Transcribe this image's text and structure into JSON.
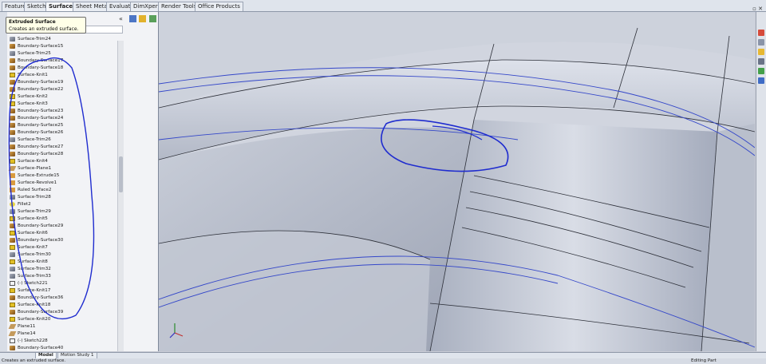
{
  "toolbar_tabs": [
    "Features",
    "Sketch",
    "Surfaces",
    "Sheet Metal",
    "Evaluate",
    "DimXpert",
    "Render Tools",
    "Office Products"
  ],
  "active_tab": "Surfaces",
  "tooltip": {
    "title": "Extruded Surface",
    "description": "Creates an extruded surface."
  },
  "tree_items": [
    {
      "label": "Surface-Trim24",
      "icon": "st"
    },
    {
      "label": "Boundary-Surface15",
      "icon": "bs"
    },
    {
      "label": "Surface-Trim25",
      "icon": "st"
    },
    {
      "label": "Boundary-Surface17",
      "icon": "bs"
    },
    {
      "label": "Boundary-Surface18",
      "icon": "bs"
    },
    {
      "label": "Surface-Knit1",
      "icon": "kn"
    },
    {
      "label": "Boundary-Surface19",
      "icon": "bs"
    },
    {
      "label": "Boundary-Surface22",
      "icon": "bs"
    },
    {
      "label": "Surface-Knit2",
      "icon": "kn"
    },
    {
      "label": "Surface-Knit3",
      "icon": "kn"
    },
    {
      "label": "Boundary-Surface23",
      "icon": "bs"
    },
    {
      "label": "Boundary-Surface24",
      "icon": "bs"
    },
    {
      "label": "Boundary-Surface25",
      "icon": "bs"
    },
    {
      "label": "Boundary-Surface26",
      "icon": "bs"
    },
    {
      "label": "Surface-Trim26",
      "icon": "st"
    },
    {
      "label": "Boundary-Surface27",
      "icon": "bs"
    },
    {
      "label": "Boundary-Surface28",
      "icon": "bs"
    },
    {
      "label": "Surface-Knit4",
      "icon": "kn"
    },
    {
      "label": "Surface-Plane1",
      "icon": "pl"
    },
    {
      "label": "Surface-Extrude15",
      "icon": "ex"
    },
    {
      "label": "Surface-Revolve1",
      "icon": "ex"
    },
    {
      "label": "Ruled Surface2",
      "icon": "ex"
    },
    {
      "label": "Surface-Trim28",
      "icon": "st"
    },
    {
      "label": "Fillet2",
      "icon": "fi"
    },
    {
      "label": "Surface-Trim29",
      "icon": "st"
    },
    {
      "label": "Surface-Knit5",
      "icon": "kn"
    },
    {
      "label": "Boundary-Surface29",
      "icon": "bs"
    },
    {
      "label": "Surface-Knit6",
      "icon": "kn"
    },
    {
      "label": "Boundary-Surface30",
      "icon": "bs"
    },
    {
      "label": "Surface-Knit7",
      "icon": "kn"
    },
    {
      "label": "Surface-Trim30",
      "icon": "st"
    },
    {
      "label": "Surface-Knit8",
      "icon": "kn"
    },
    {
      "label": "Surface-Trim32",
      "icon": "st"
    },
    {
      "label": "Surface-Trim33",
      "icon": "st"
    },
    {
      "label": "(-) Sketch221",
      "icon": "sk"
    },
    {
      "label": "Surface-Knit17",
      "icon": "kn"
    },
    {
      "label": "Boundary-Surface36",
      "icon": "bs"
    },
    {
      "label": "Surface-Knit18",
      "icon": "kn"
    },
    {
      "label": "Boundary-Surface39",
      "icon": "bs"
    },
    {
      "label": "Surface-Knit20",
      "icon": "kn"
    },
    {
      "label": "Plane11",
      "icon": "pl"
    },
    {
      "label": "Plane14",
      "icon": "pl"
    },
    {
      "label": "(-) Sketch228",
      "icon": "sk"
    },
    {
      "label": "Boundary-Surface40",
      "icon": "bs"
    }
  ],
  "bottom_tabs": [
    "Model",
    "Motion Study 1"
  ],
  "status": {
    "left": "Creates an extruded surface.",
    "right": "Editing Part"
  },
  "colors": {
    "annotation_ink": "#1f2ccf",
    "surface_face": "#c3c9d6",
    "edge_line": "#2c2f38"
  }
}
